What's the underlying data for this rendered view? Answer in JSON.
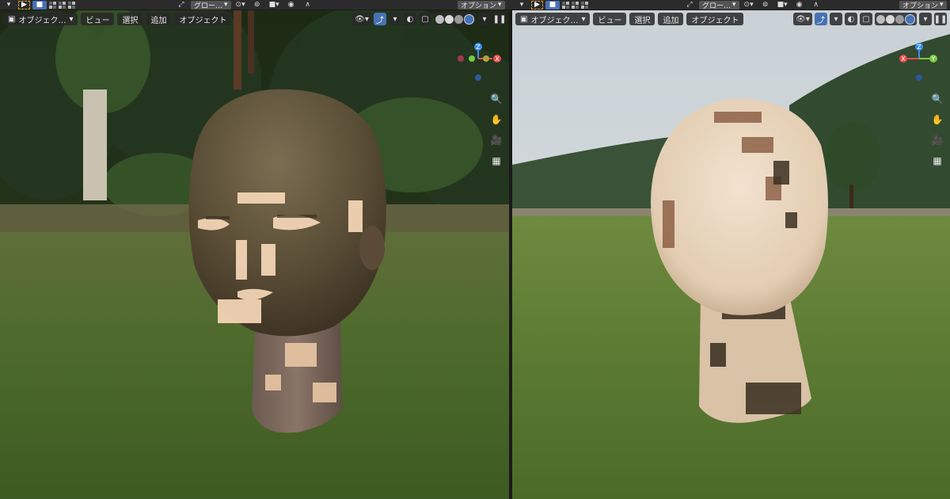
{
  "top": {
    "left_dropdown": "グロー…",
    "options_label": "オプション",
    "options_label_right": "オプション",
    "right_dropdown": "グロー…"
  },
  "left_viewport": {
    "mode": "オブジェク…",
    "menus": [
      "ビュー",
      "選択",
      "追加",
      "オブジェクト"
    ],
    "gizmo": {
      "z": "Z",
      "x": "X"
    }
  },
  "right_viewport": {
    "mode": "オブジェク…",
    "menus": [
      "ビュー",
      "選択",
      "追加",
      "オブジェクト"
    ],
    "gizmo": {
      "z": "Z",
      "x": "X",
      "y": "Y"
    }
  },
  "colors": {
    "accent": "#4772b3",
    "axis_x": "#e64a4a",
    "axis_y": "#7ac943",
    "axis_z": "#3a8ff0"
  },
  "icons": [
    "cursor-icon",
    "select-box-icon",
    "transform-icon",
    "snap-icon",
    "proportional-icon",
    "visibility-icon",
    "gizmo-icon",
    "overlay-icon",
    "xray-icon",
    "wireframe-icon",
    "solid-icon",
    "material-icon",
    "rendered-icon",
    "zoom-icon",
    "hand-icon",
    "camera-icon",
    "grid-icon"
  ]
}
